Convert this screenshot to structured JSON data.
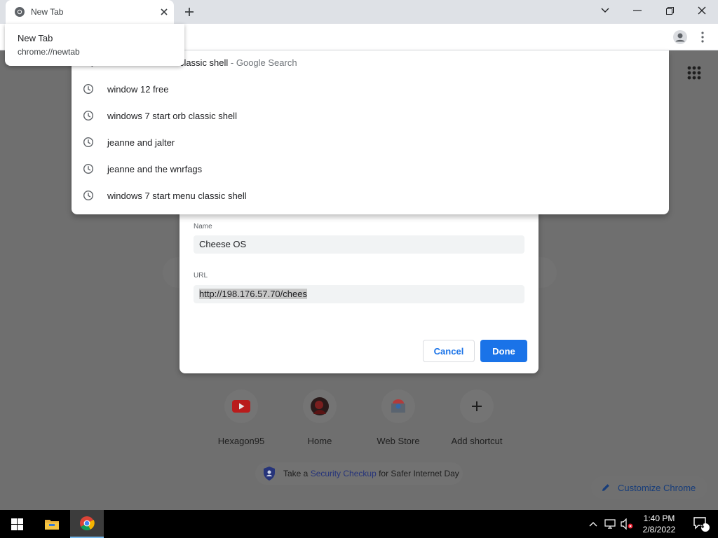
{
  "browser": {
    "tab_title": "New Tab",
    "hovercard": {
      "title": "New Tab",
      "url": "chrome://newtab"
    }
  },
  "omnibox": {
    "suggestions": [
      {
        "text": "r classic shell",
        "separator": " - ",
        "suffix": "Google Search",
        "icon": "search-icon"
      },
      {
        "text": "window 12 free",
        "icon": "history-clock-icon"
      },
      {
        "text": "windows 7 start orb classic shell",
        "icon": "history-clock-icon"
      },
      {
        "text": "jeanne and jalter",
        "icon": "history-clock-icon"
      },
      {
        "text": "jeanne and the wnrfags",
        "icon": "history-clock-icon"
      },
      {
        "text": "windows 7 start menu classic shell",
        "icon": "history-clock-icon"
      }
    ]
  },
  "dialog": {
    "name_label": "Name",
    "name_value": "Cheese OS",
    "url_label": "URL",
    "url_value": "http://198.176.57.70/chees",
    "cancel_label": "Cancel",
    "done_label": "Done"
  },
  "shortcuts": [
    {
      "label": "Hexagon95",
      "icon": "youtube-icon"
    },
    {
      "label": "Home",
      "icon": "avatar-icon"
    },
    {
      "label": "Web Store",
      "icon": "web-store-icon"
    },
    {
      "label": "Add shortcut",
      "icon": "plus-icon"
    }
  ],
  "security_checkup": {
    "prefix": "Take a ",
    "link": "Security Checkup",
    "suffix": " for Safer Internet Day"
  },
  "customize_label": "Customize Chrome",
  "taskbar": {
    "time": "1:40 PM",
    "date": "2/8/2022",
    "notifications": "4"
  },
  "colors": {
    "accent": "#1a73e8",
    "dim_overlay": "#6f6f6f",
    "taskbar": "#000000"
  }
}
